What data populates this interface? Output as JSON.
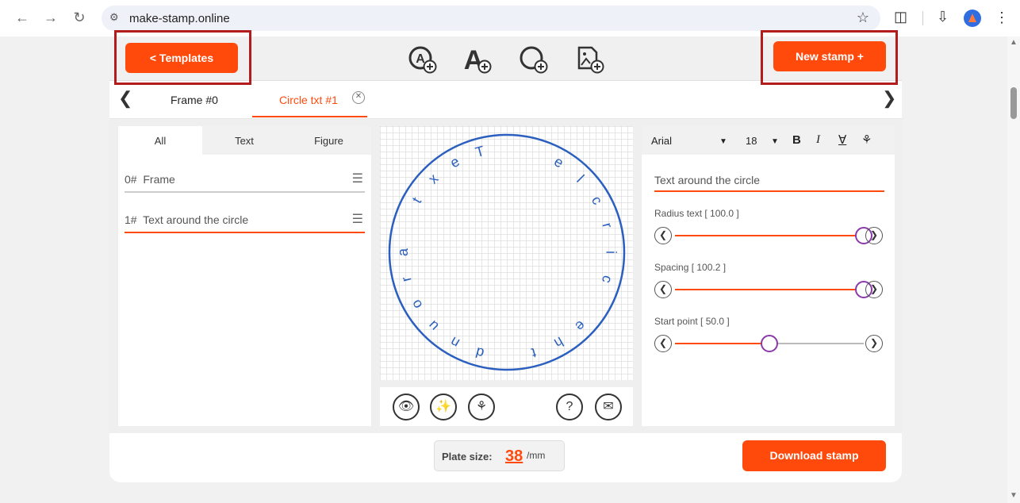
{
  "browser": {
    "url": "make-stamp.online"
  },
  "toolbar": {
    "templates_label": "< Templates",
    "new_stamp_label": "New stamp +",
    "tools": [
      "add-circle-text-tool",
      "add-text-tool",
      "add-figure-tool",
      "add-image-tool"
    ]
  },
  "tabs": {
    "items": [
      {
        "label": "Frame #0"
      },
      {
        "label": "Circle txt #1"
      }
    ],
    "active_index": 1
  },
  "layers": {
    "filters": [
      "All",
      "Text",
      "Figure"
    ],
    "items": [
      {
        "index": "0#",
        "label": "Frame"
      },
      {
        "index": "1#",
        "label": "Text around the circle"
      }
    ]
  },
  "canvas": {
    "circle_text": "Text around the circle"
  },
  "properties": {
    "font": "Arial",
    "size": "18",
    "text_value": "Text around the circle",
    "sliders": [
      {
        "label": "Radius text [ 100.0 ]",
        "level": 1.0
      },
      {
        "label": "Spacing [ 100.2 ]",
        "level": 1.0
      },
      {
        "label": "Start point [ 50.0 ]",
        "level": 0.5
      }
    ]
  },
  "footer": {
    "plate_label": "Plate size:",
    "plate_value": "38",
    "plate_unit": "/mm",
    "download_label": "Download stamp"
  },
  "colors": {
    "accent": "#ff4a0c",
    "highlight_box": "#b21c1c",
    "stamp_blue": "#2a5fbf",
    "knob": "#8a3aa8"
  }
}
